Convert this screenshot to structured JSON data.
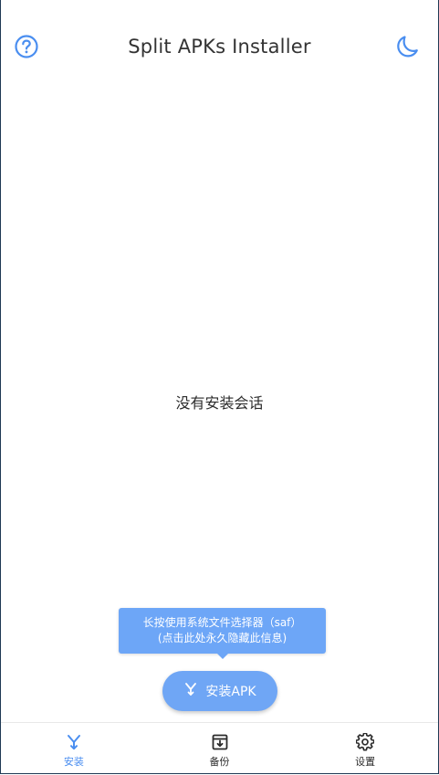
{
  "app": {
    "title": "Split APKs Installer"
  },
  "appbar": {
    "help_icon": "help-circle-icon",
    "theme_icon": "moon-icon"
  },
  "main": {
    "empty_message": "没有安装会话"
  },
  "tooltip": {
    "line1": "长按使用系统文件选择器（saf）",
    "line2": "(点击此处永久隐藏此信息)"
  },
  "fab": {
    "label": "安装APK",
    "icon": "install-split-icon"
  },
  "bottom_nav": {
    "items": [
      {
        "label": "安装",
        "icon": "install-split-icon",
        "active": true
      },
      {
        "label": "备份",
        "icon": "archive-download-icon",
        "active": false
      },
      {
        "label": "设置",
        "icon": "gear-icon",
        "active": false
      }
    ]
  },
  "colors": {
    "accent": "#4a8ef0",
    "fab_bg": "#6fa6f5",
    "tooltip_bg": "#6da6f7",
    "text": "#2b2b2b"
  }
}
